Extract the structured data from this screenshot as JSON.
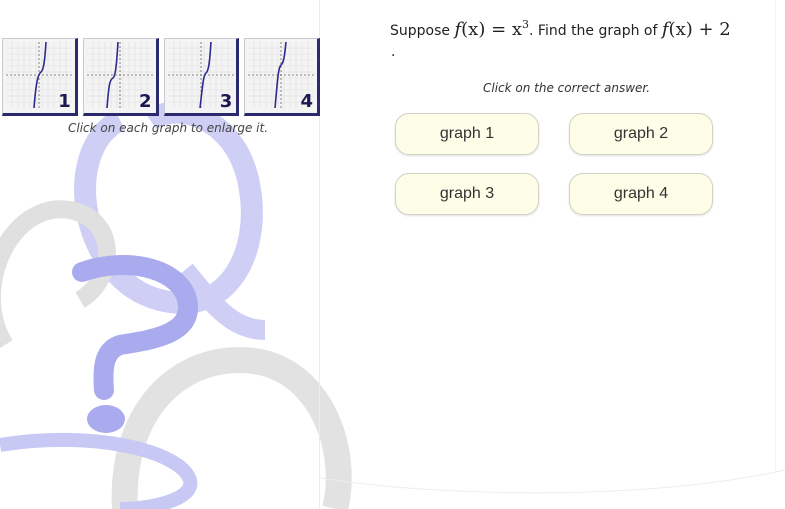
{
  "thumbnails": [
    {
      "number": "1"
    },
    {
      "number": "2"
    },
    {
      "number": "3"
    },
    {
      "number": "4"
    }
  ],
  "enlarge_note": "Click on each graph to enlarge it.",
  "question": {
    "prefix": "Suppose ",
    "f1": "f",
    "arg1": "(x)",
    "equals": " = x",
    "exponent": "3",
    "middle": ". Find the graph of ",
    "f2": "f",
    "arg2": "(x)",
    "plus": " + 2",
    "trailing": "."
  },
  "instruction": "Click on the correct answer.",
  "answers": [
    {
      "label": "graph 1"
    },
    {
      "label": "graph 2"
    },
    {
      "label": "graph 3"
    },
    {
      "label": "graph 4"
    }
  ],
  "colors": {
    "watermark_lavender": "#c8c8f4",
    "watermark_blue": "#a6a6ec",
    "watermark_gray": "#e2e2e2",
    "answer_bg": "#fdfde8",
    "thumb_border": "#2c2a6e"
  }
}
